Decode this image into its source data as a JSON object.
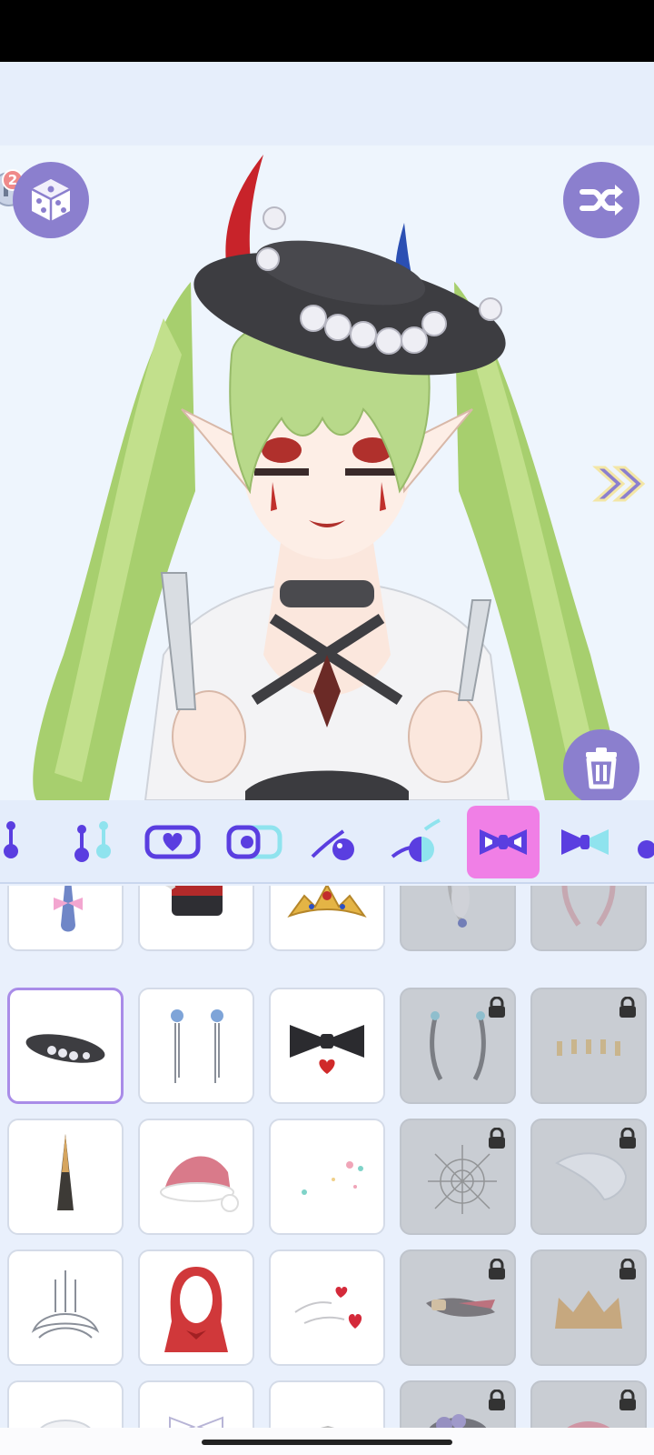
{
  "preview": {
    "hint_count": "2",
    "icons": {
      "dice": "dice-icon",
      "shuffle": "shuffle-icon",
      "trash": "trash-icon",
      "next": "double-chevron-right-icon",
      "hint": "lightbulb-icon"
    }
  },
  "colors": {
    "button": "#8b7fce",
    "category_selected": "#f07fe6",
    "accent_icon": "#5a3ee0",
    "selected_border": "#a98ce8",
    "locked_tile": "#c9cdd3"
  },
  "categories": [
    {
      "name": "earring-single-icon",
      "selected": false
    },
    {
      "name": "earring-pair-icon",
      "selected": false
    },
    {
      "name": "choker-heart-icon",
      "selected": false
    },
    {
      "name": "choker-pair-icon",
      "selected": false
    },
    {
      "name": "necklace-pendant-icon",
      "selected": false
    },
    {
      "name": "necklace-pair-icon",
      "selected": false
    },
    {
      "name": "bow-accessory-icon",
      "selected": true
    },
    {
      "name": "bow-pair-icon",
      "selected": false
    },
    {
      "name": "more-category-icon",
      "selected": false
    }
  ],
  "items": [
    {
      "name": "pink-bow-horn-item",
      "locked": false,
      "selected": false
    },
    {
      "name": "marching-hat-item",
      "locked": false,
      "selected": false
    },
    {
      "name": "gold-tiara-item",
      "locked": false,
      "selected": false
    },
    {
      "name": "feather-earring-item",
      "locked": true,
      "selected": false
    },
    {
      "name": "pink-feathers-item",
      "locked": true,
      "selected": false
    },
    {
      "name": "black-boater-hat-item",
      "locked": false,
      "selected": true
    },
    {
      "name": "flower-drop-earrings-item",
      "locked": false,
      "selected": false
    },
    {
      "name": "black-bow-heart-item",
      "locked": false,
      "selected": false
    },
    {
      "name": "curved-hairpins-item",
      "locked": true,
      "selected": false
    },
    {
      "name": "gold-studs-item",
      "locked": true,
      "selected": false
    },
    {
      "name": "spiral-horn-item",
      "locked": false,
      "selected": false
    },
    {
      "name": "santa-hat-item",
      "locked": false,
      "selected": false
    },
    {
      "name": "sparkle-dots-item",
      "locked": false,
      "selected": false
    },
    {
      "name": "spider-web-item",
      "locked": true,
      "selected": false
    },
    {
      "name": "white-beret-item",
      "locked": true,
      "selected": false
    },
    {
      "name": "silver-headdress-item",
      "locked": false,
      "selected": false
    },
    {
      "name": "red-hood-item",
      "locked": false,
      "selected": false
    },
    {
      "name": "heart-stickers-item",
      "locked": false,
      "selected": false
    },
    {
      "name": "feather-clip-item",
      "locked": true,
      "selected": false
    },
    {
      "name": "gold-crown-item",
      "locked": true,
      "selected": false
    },
    {
      "name": "white-cap-item",
      "locked": false,
      "selected": false
    },
    {
      "name": "white-ribbon-item",
      "locked": false,
      "selected": false
    },
    {
      "name": "small-accessory-item",
      "locked": false,
      "selected": false
    },
    {
      "name": "purple-flower-hat-item",
      "locked": true,
      "selected": false
    },
    {
      "name": "pink-hair-piece-item",
      "locked": true,
      "selected": false
    }
  ]
}
